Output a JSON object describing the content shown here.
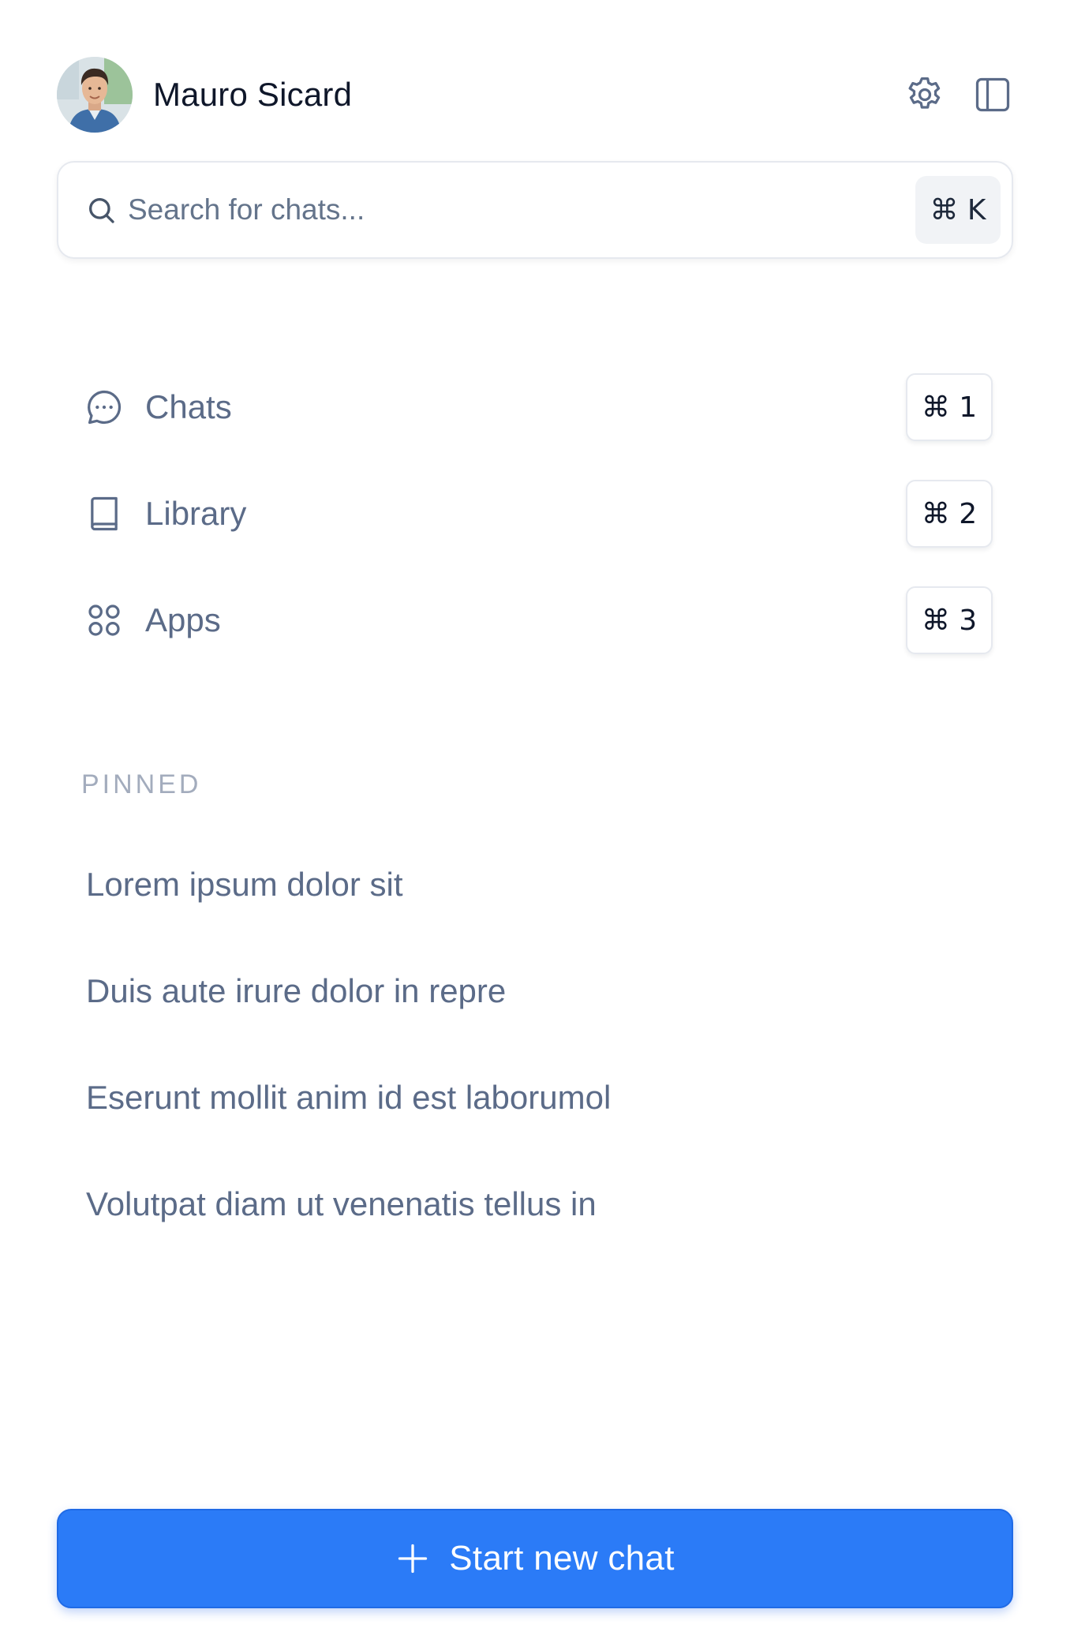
{
  "user": {
    "name": "Mauro Sicard"
  },
  "header": {
    "settings_icon": "gear-icon",
    "panel_icon": "sidebar-toggle-icon"
  },
  "search": {
    "placeholder": "Search for chats...",
    "shortcut": "⌘ K"
  },
  "nav": {
    "items": [
      {
        "label": "Chats",
        "icon": "chat-bubble-icon",
        "shortcut": "⌘ 1"
      },
      {
        "label": "Library",
        "icon": "book-icon",
        "shortcut": "⌘ 2"
      },
      {
        "label": "Apps",
        "icon": "apps-grid-icon",
        "shortcut": "⌘ 3"
      }
    ]
  },
  "pinned": {
    "heading": "PINNED",
    "items": [
      {
        "label": "Lorem ipsum dolor sit"
      },
      {
        "label": "Duis aute irure dolor in repre"
      },
      {
        "label": "Eserunt mollit anim id est laborumol"
      },
      {
        "label": "Volutpat diam ut venenatis tellus in"
      }
    ]
  },
  "new_chat": {
    "label": "Start new chat",
    "icon": "plus-icon"
  },
  "colors": {
    "accent": "#2b7bf7",
    "text_primary": "#0f172a",
    "text_secondary": "#5b6b88",
    "heading_muted": "#a3acbd",
    "border": "#e6e9ef"
  }
}
